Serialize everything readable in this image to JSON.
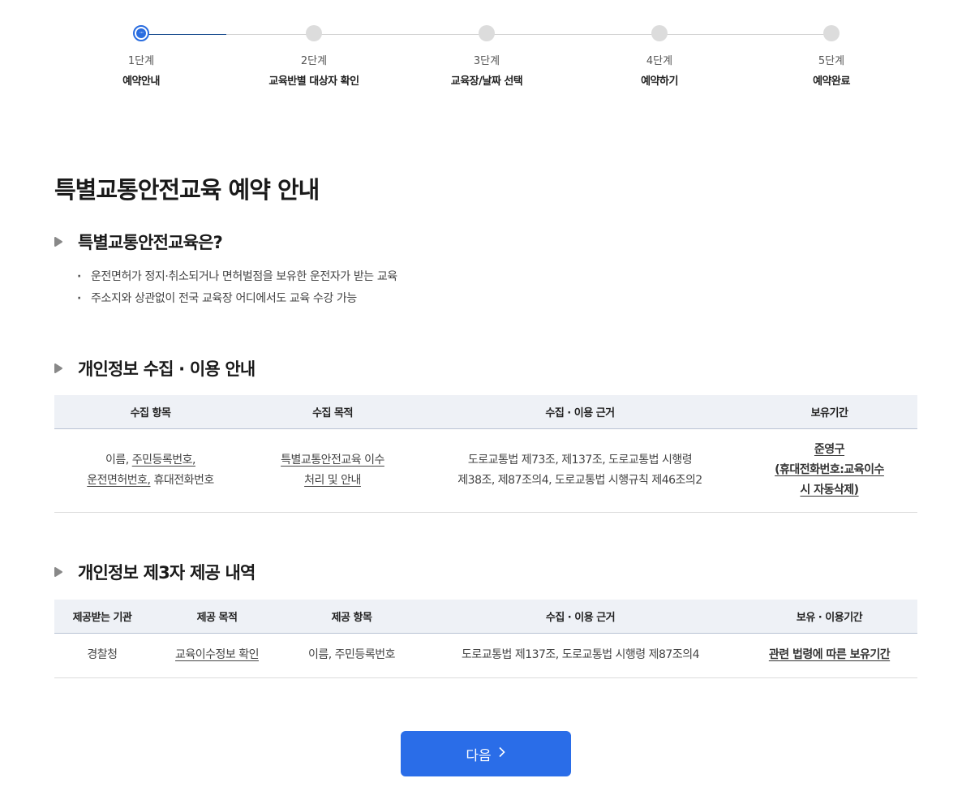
{
  "stepper": {
    "steps": [
      {
        "num": "1단계",
        "name": "예약안내"
      },
      {
        "num": "2단계",
        "name": "교육반별 대상자 확인"
      },
      {
        "num": "3단계",
        "name": "교육장/날짜 선택"
      },
      {
        "num": "4단계",
        "name": "예약하기"
      },
      {
        "num": "5단계",
        "name": "예약완료"
      }
    ],
    "current_dot": "···"
  },
  "page_title": "특별교통안전교육 예약 안내",
  "section1": {
    "title": "특별교통안전교육은?",
    "items": [
      "운전면허가 정지·취소되거나 면허벌점을 보유한 운전자가 받는 교육",
      "주소지와 상관없이 전국 교육장 어디에서도 교육 수강 가능"
    ]
  },
  "section2": {
    "title": "개인정보 수집 · 이용 안내",
    "headers": [
      "수집 항목",
      "수집 목적",
      "수집 · 이용 근거",
      "보유기간"
    ],
    "row": {
      "c1_a": "이름, ",
      "c1_b": "주민등록번호,",
      "c1_c": "운전면허번호,",
      "c1_d": " 휴대전화번호",
      "c2_a": "특별교통안전교육 이수",
      "c2_b": "처리 및 안내",
      "c3_a": "도로교통법 제73조, 제137조, 도로교통법 시행령",
      "c3_b": "제38조, 제87조의4, 도로교통법 시행규칙 제46조의2",
      "c4_a": "준영구",
      "c4_b": "(휴대전화번호:교육이수",
      "c4_c": "시 자동삭제)"
    }
  },
  "section3": {
    "title": "개인정보 제3자 제공 내역",
    "headers": [
      "제공받는 기관",
      "제공 목적",
      "제공 항목",
      "수집 · 이용 근거",
      "보유 · 이용기간"
    ],
    "row": [
      "경찰청",
      "교육이수정보 확인",
      "이름, 주민등록번호",
      "도로교통법 제137조, 도로교통법 시행령 제87조의4",
      "관련 법령에 따른 보유기간"
    ]
  },
  "next_button": {
    "label": "다음",
    "icon": "chevron-right-icon"
  },
  "colors": {
    "accent": "#2a6de8",
    "progress": "#1d4f91",
    "header_bg": "#eef1f6"
  }
}
